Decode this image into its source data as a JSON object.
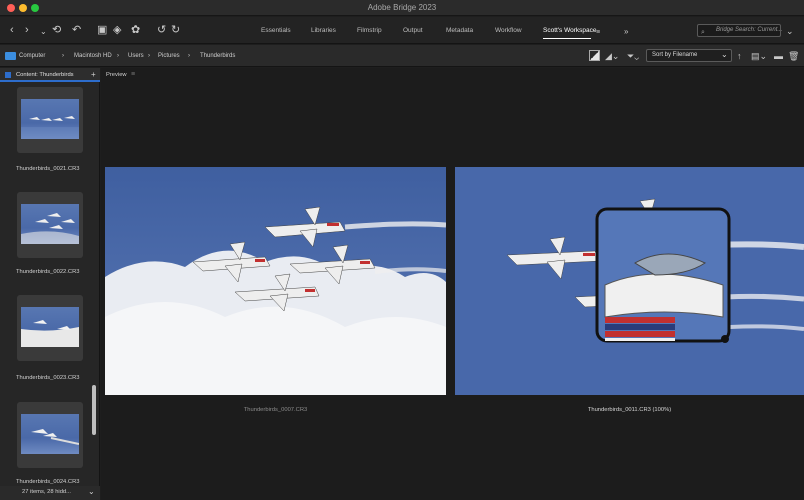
{
  "window": {
    "title": "Adobe Bridge 2023"
  },
  "workspaces": [
    "Essentials",
    "Libraries",
    "Filmstrip",
    "Output",
    "Metadata",
    "Workflow",
    "Scott's Workspace"
  ],
  "active_workspace": "Scott's Workspace",
  "search": {
    "placeholder": "Bridge Search: Current..."
  },
  "breadcrumb": [
    "Computer",
    "Macintosh HD",
    "Users",
    "Pictures",
    "Thunderbirds"
  ],
  "sort": {
    "label": "Sort by Filename"
  },
  "content_panel": {
    "title": "Content: Thunderbirds",
    "files": [
      "Thunderbirds_0021.CR3",
      "Thunderbirds_0022.CR3",
      "Thunderbirds_0023.CR3",
      "Thunderbirds_0024.CR3"
    ],
    "footer": "27 items, 28 hidd..."
  },
  "preview": {
    "title": "Preview",
    "left_caption": "Thunderbirds_0007.CR3",
    "right_caption": "Thunderbirds_0011.CR3 (100%)"
  },
  "colors": {
    "accent": "#2d6dcc",
    "sky": "#4a69a8"
  }
}
